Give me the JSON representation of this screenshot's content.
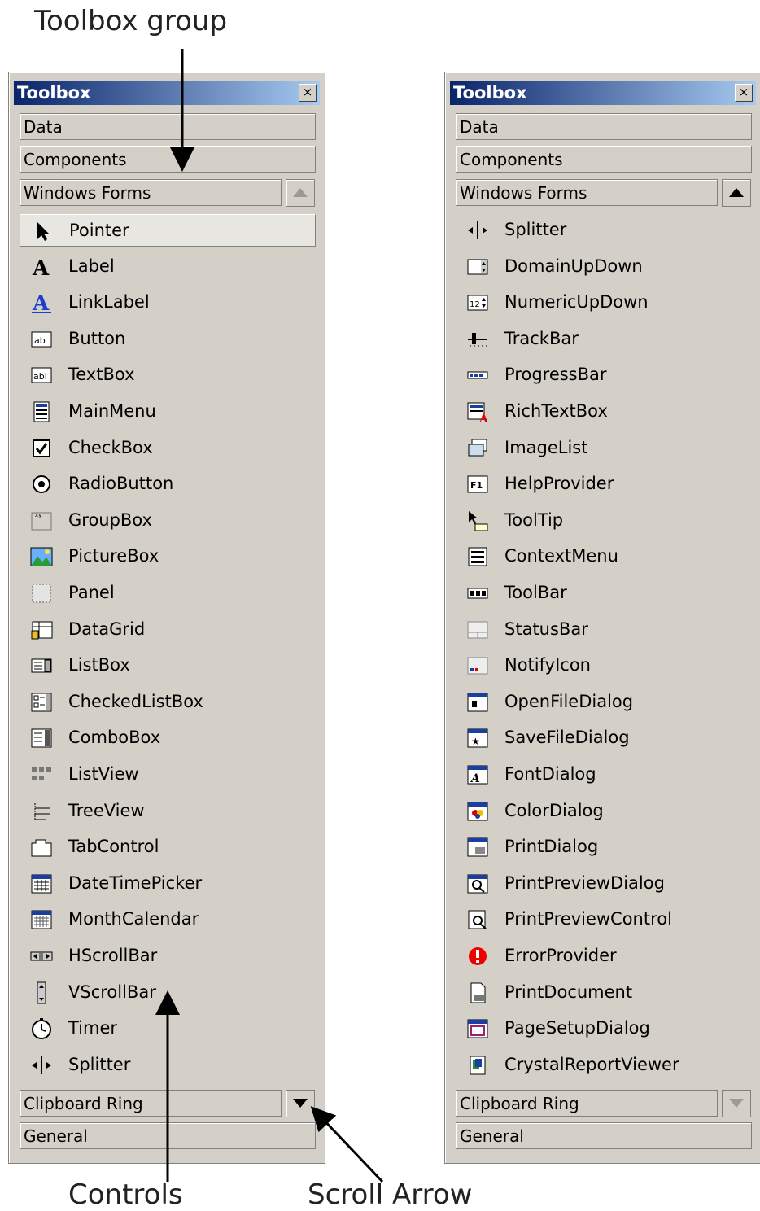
{
  "annotations": {
    "toolbox_group": "Toolbox group",
    "controls": "Controls",
    "scroll_arrow": "Scroll Arrow"
  },
  "left_panel": {
    "title": "Toolbox",
    "close": "×",
    "sections_top": [
      "Data",
      "Components",
      "Windows Forms"
    ],
    "items": [
      {
        "label": "Pointer",
        "icon": "pointer-icon",
        "selected": true
      },
      {
        "label": "Label",
        "icon": "label-icon"
      },
      {
        "label": "LinkLabel",
        "icon": "linklabel-icon"
      },
      {
        "label": "Button",
        "icon": "button-icon"
      },
      {
        "label": "TextBox",
        "icon": "textbox-icon"
      },
      {
        "label": "MainMenu",
        "icon": "mainmenu-icon"
      },
      {
        "label": "CheckBox",
        "icon": "checkbox-icon"
      },
      {
        "label": "RadioButton",
        "icon": "radiobutton-icon"
      },
      {
        "label": "GroupBox",
        "icon": "groupbox-icon"
      },
      {
        "label": "PictureBox",
        "icon": "picturebox-icon"
      },
      {
        "label": "Panel",
        "icon": "panel-icon"
      },
      {
        "label": "DataGrid",
        "icon": "datagrid-icon"
      },
      {
        "label": "ListBox",
        "icon": "listbox-icon"
      },
      {
        "label": "CheckedListBox",
        "icon": "checkedlistbox-icon"
      },
      {
        "label": "ComboBox",
        "icon": "combobox-icon"
      },
      {
        "label": "ListView",
        "icon": "listview-icon"
      },
      {
        "label": "TreeView",
        "icon": "treeview-icon"
      },
      {
        "label": "TabControl",
        "icon": "tabcontrol-icon"
      },
      {
        "label": "DateTimePicker",
        "icon": "datetimepicker-icon"
      },
      {
        "label": "MonthCalendar",
        "icon": "monthcalendar-icon"
      },
      {
        "label": "HScrollBar",
        "icon": "hscrollbar-icon"
      },
      {
        "label": "VScrollBar",
        "icon": "vscrollbar-icon"
      },
      {
        "label": "Timer",
        "icon": "timer-icon"
      },
      {
        "label": "Splitter",
        "icon": "splitter-icon"
      }
    ],
    "sections_bottom": [
      "Clipboard Ring",
      "General"
    ]
  },
  "right_panel": {
    "title": "Toolbox",
    "close": "×",
    "sections_top": [
      "Data",
      "Components",
      "Windows Forms"
    ],
    "items": [
      {
        "label": "Splitter",
        "icon": "splitter-icon"
      },
      {
        "label": "DomainUpDown",
        "icon": "domainupdown-icon"
      },
      {
        "label": "NumericUpDown",
        "icon": "numericupdown-icon"
      },
      {
        "label": "TrackBar",
        "icon": "trackbar-icon"
      },
      {
        "label": "ProgressBar",
        "icon": "progressbar-icon"
      },
      {
        "label": "RichTextBox",
        "icon": "richtextbox-icon"
      },
      {
        "label": "ImageList",
        "icon": "imagelist-icon"
      },
      {
        "label": "HelpProvider",
        "icon": "helpprovider-icon"
      },
      {
        "label": "ToolTip",
        "icon": "tooltip-icon"
      },
      {
        "label": "ContextMenu",
        "icon": "contextmenu-icon"
      },
      {
        "label": "ToolBar",
        "icon": "toolbar-icon"
      },
      {
        "label": "StatusBar",
        "icon": "statusbar-icon"
      },
      {
        "label": "NotifyIcon",
        "icon": "notifyicon-icon"
      },
      {
        "label": "OpenFileDialog",
        "icon": "openfiledialog-icon"
      },
      {
        "label": "SaveFileDialog",
        "icon": "savefiledialog-icon"
      },
      {
        "label": "FontDialog",
        "icon": "fontdialog-icon"
      },
      {
        "label": "ColorDialog",
        "icon": "colordialog-icon"
      },
      {
        "label": "PrintDialog",
        "icon": "printdialog-icon"
      },
      {
        "label": "PrintPreviewDialog",
        "icon": "printpreviewdialog-icon"
      },
      {
        "label": "PrintPreviewControl",
        "icon": "printpreviewcontrol-icon"
      },
      {
        "label": "ErrorProvider",
        "icon": "errorprovider-icon"
      },
      {
        "label": "PrintDocument",
        "icon": "printdocument-icon"
      },
      {
        "label": "PageSetupDialog",
        "icon": "pagesetupdialog-icon"
      },
      {
        "label": "CrystalReportViewer",
        "icon": "crystalreportviewer-icon"
      }
    ],
    "sections_bottom": [
      "Clipboard Ring",
      "General"
    ]
  },
  "colors": {
    "panel_bg": "#d4d0c8",
    "titlebar_start": "#0a246a",
    "titlebar_end": "#a6caf0"
  }
}
